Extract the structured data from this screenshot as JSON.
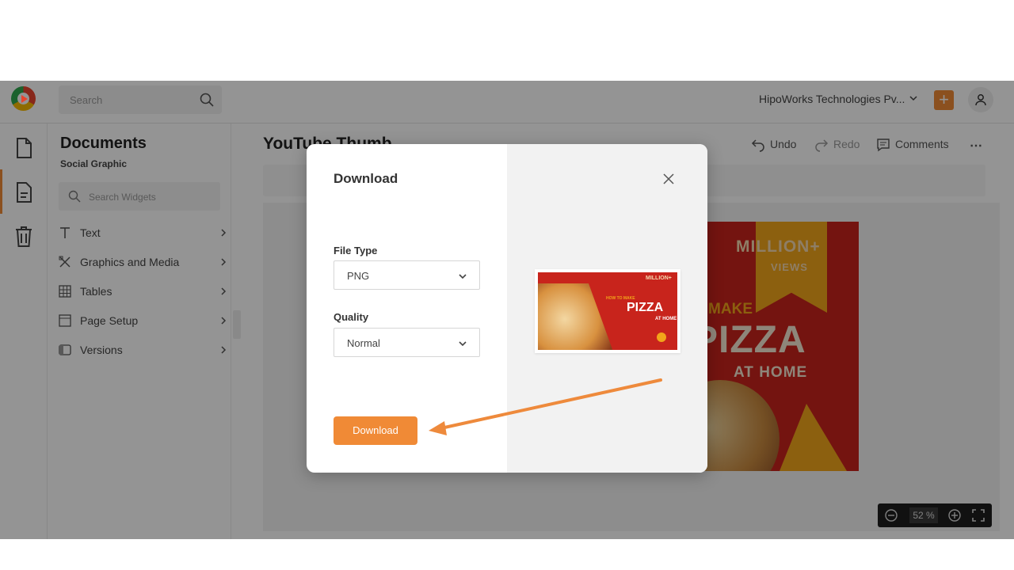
{
  "topbar": {
    "search_placeholder": "Search",
    "org_name": "HipoWorks Technologies Pv...",
    "add_label": "+"
  },
  "panel": {
    "title": "Documents",
    "subtitle": "Social Graphic",
    "search_placeholder": "Search Widgets",
    "items": [
      {
        "label": "Text",
        "icon": "text-icon"
      },
      {
        "label": "Graphics and Media",
        "icon": "graphics-icon"
      },
      {
        "label": "Tables",
        "icon": "table-icon"
      },
      {
        "label": "Page Setup",
        "icon": "page-setup-icon"
      },
      {
        "label": "Versions",
        "icon": "versions-icon"
      }
    ]
  },
  "main": {
    "doc_title": "YouTube Thumb",
    "undo_label": "Undo",
    "redo_label": "Redo",
    "comments_label": "Comments",
    "more_label": "⋯",
    "zoom_value": "52 %"
  },
  "thumbnail": {
    "million": "MILLION+",
    "views": "VIEWS",
    "make": "O MAKE",
    "pizza": "PIZZA",
    "at_home": "AT HOME"
  },
  "modal": {
    "title": "Download",
    "file_type_label": "File Type",
    "file_type_value": "PNG",
    "quality_label": "Quality",
    "quality_value": "Normal",
    "download_button": "Download"
  },
  "preview": {
    "million": "MILLION+",
    "how_to": "HOW TO MAKE",
    "pizza": "PIZZA",
    "at_home": "AT HOME"
  },
  "colors": {
    "accent": "#f08a36",
    "pizza_red": "#c8241c",
    "pizza_yellow": "#f2a51a"
  }
}
